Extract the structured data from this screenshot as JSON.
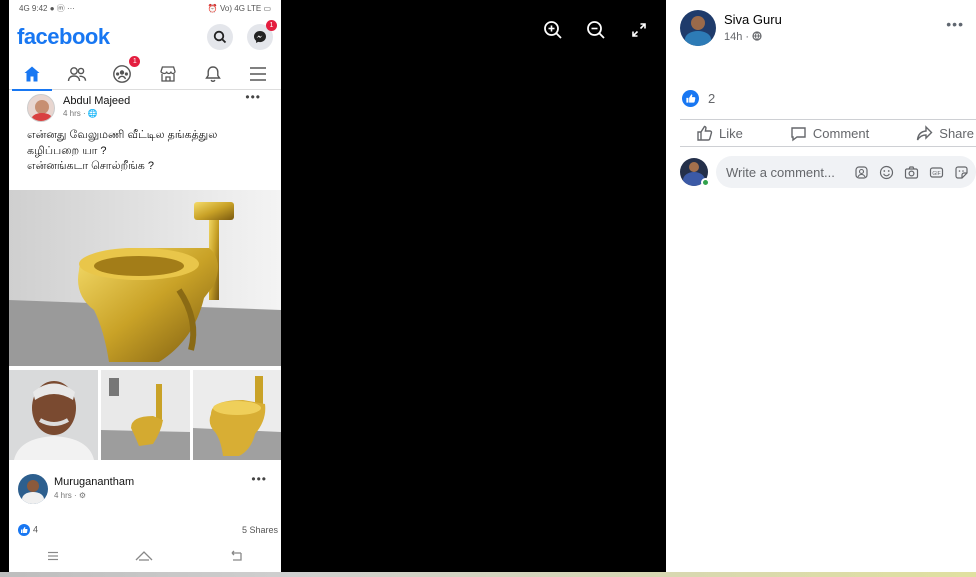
{
  "phone": {
    "status_left": "4G 9:42 ● ⓜ ···",
    "status_right": "⏰ Vo) 4G LTE ▭",
    "logo": "facebook",
    "messenger_badge": "1",
    "groups_badge": "1",
    "post1": {
      "author": "Abdul Majeed",
      "meta": "4 hrs · 🌐",
      "text_line1": "என்னது வேலுமணி வீட்டில தங்கத்துல",
      "text_line2": "கழிப்பறை யா ?",
      "text_line3": "என்னங்கடா சொல்றீங்க ?"
    },
    "post2": {
      "author": "Muruganantham",
      "meta": "4 hrs · ⚙"
    },
    "reaction_count": "4",
    "shares": "5 Shares"
  },
  "panel": {
    "author": "Siva Guru",
    "time": "14h · ",
    "like_count": "2",
    "actions": {
      "like": "Like",
      "comment": "Comment",
      "share": "Share"
    },
    "comment_placeholder": "Write a comment..."
  },
  "colors": {
    "facebook_blue": "#1877f2",
    "badge_red": "#e41e3f",
    "online_green": "#31a24c",
    "gold": "#c9a227"
  }
}
